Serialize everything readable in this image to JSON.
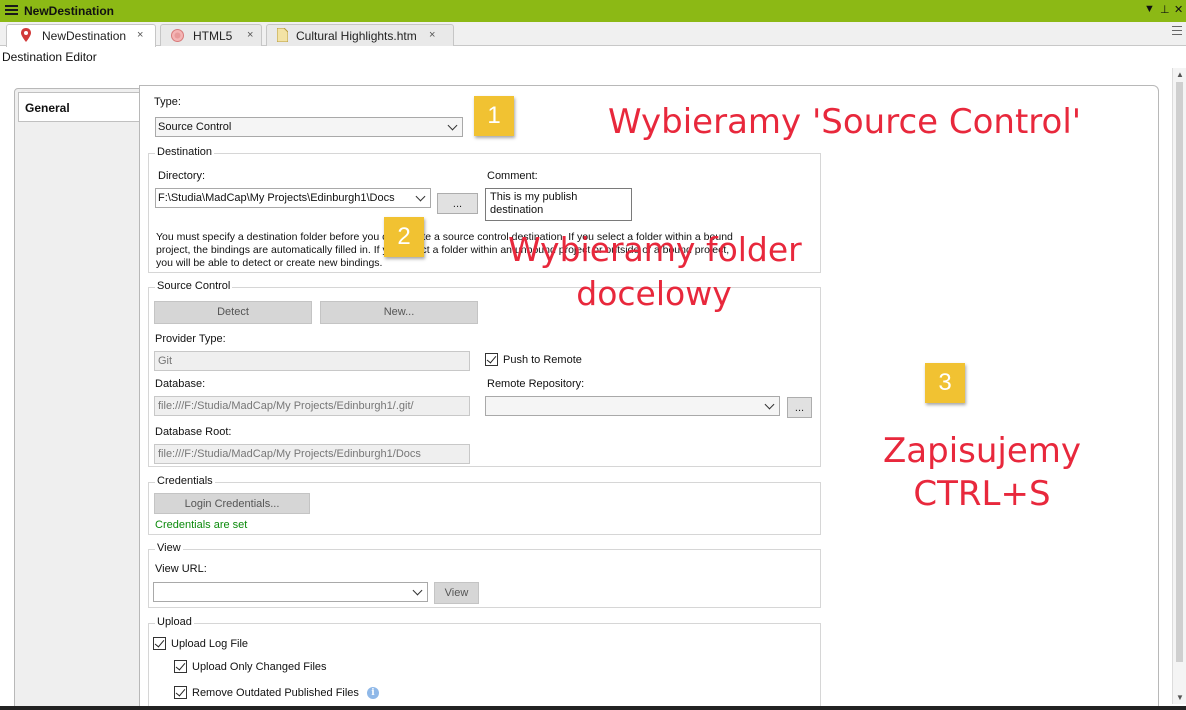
{
  "window": {
    "title": "NewDestination"
  },
  "tabs": [
    {
      "label": "NewDestination",
      "close": "×",
      "active": true,
      "icon": "map-pin-icon"
    },
    {
      "label": "HTML5",
      "close": "×",
      "active": false,
      "icon": "target-icon"
    },
    {
      "label": "Cultural Highlights.htm",
      "close": "×",
      "active": false,
      "icon": "document-icon"
    }
  ],
  "editor": {
    "title": "Destination Editor",
    "side_tab": "General"
  },
  "type": {
    "label": "Type:",
    "value": "Source Control"
  },
  "destination": {
    "group": "Destination",
    "directory_label": "Directory:",
    "directory_value": "F:\\Studia\\MadCap\\My Projects\\Edinburgh1\\Docs",
    "browse": "...",
    "comment_label": "Comment:",
    "comment_value": "This is my publish destination",
    "info_line1": "You must specify a destination folder before you can create a source control destination. If you select a folder within a bound",
    "info_line2": "project, the bindings are automatically filled in. If you select a folder within an unbound project or outside of a bound project,",
    "info_line3": "you will be able to detect or create new bindings."
  },
  "source_control": {
    "group": "Source Control",
    "detect": "Detect",
    "new": "New...",
    "provider_label": "Provider Type:",
    "provider_value": "Git",
    "push_label": "Push to Remote",
    "push_checked": true,
    "database_label": "Database:",
    "database_value": "file:///F:/Studia/MadCap/My Projects/Edinburgh1/.git/",
    "remote_label": "Remote Repository:",
    "remote_browse": "...",
    "root_label": "Database Root:",
    "root_value": "file:///F:/Studia/MadCap/My Projects/Edinburgh1/Docs"
  },
  "credentials": {
    "group": "Credentials",
    "login": "Login Credentials...",
    "status": "Credentials are set",
    "status_color": "#0b8a0b"
  },
  "view": {
    "group": "View",
    "url_label": "View URL:",
    "button": "View"
  },
  "upload": {
    "group": "Upload",
    "log": "Upload Log File",
    "changed": "Upload Only Changed Files",
    "outdated": "Remove Outdated Published Files"
  },
  "annotations": {
    "badge1": "1",
    "badge2": "2",
    "badge3": "3",
    "text1": "Wybieramy 'Source Control'",
    "text2_line1": "Wybieramy folder",
    "text2_line2": "docelowy",
    "text3_line1": "Zapisujemy",
    "text3_line2": "CTRL+S",
    "color": "#e8283c",
    "badge_color": "#f1c232"
  },
  "colors": {
    "titlebar": "#8cb915"
  }
}
